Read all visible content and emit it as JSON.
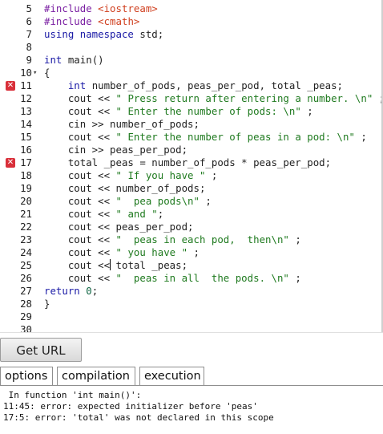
{
  "editor": {
    "lines": [
      {
        "num": "5",
        "tokens": [
          [
            "m",
            "#include "
          ],
          [
            "st",
            "<iostream>"
          ]
        ]
      },
      {
        "num": "6",
        "tokens": [
          [
            "m",
            "#include "
          ],
          [
            "st",
            "<cmath>"
          ]
        ]
      },
      {
        "num": "7",
        "tokens": [
          [
            "k",
            "using namespace"
          ],
          [
            "p",
            " std;"
          ]
        ]
      },
      {
        "num": "8",
        "tokens": []
      },
      {
        "num": "9",
        "tokens": [
          [
            "k",
            "int"
          ],
          [
            "p",
            " main()"
          ]
        ]
      },
      {
        "num": "10",
        "fold": "▾",
        "tokens": [
          [
            "p",
            "{"
          ]
        ]
      },
      {
        "num": "11",
        "error": true,
        "tokens": [
          [
            "p",
            "    "
          ],
          [
            "k",
            "int"
          ],
          [
            "p",
            " number_of_pods, peas_per_pod, total _peas;"
          ]
        ]
      },
      {
        "num": "12",
        "tokens": [
          [
            "p",
            "    cout << "
          ],
          [
            "s",
            "\" Press return after entering a number. \\n\""
          ],
          [
            "p",
            " ;"
          ]
        ]
      },
      {
        "num": "13",
        "tokens": [
          [
            "p",
            "    cout << "
          ],
          [
            "s",
            "\" Enter the number of pods: \\n\""
          ],
          [
            "p",
            " ;"
          ]
        ]
      },
      {
        "num": "14",
        "tokens": [
          [
            "p",
            "    cin >> number_of_pods;"
          ]
        ]
      },
      {
        "num": "15",
        "tokens": [
          [
            "p",
            "    cout << "
          ],
          [
            "s",
            "\" Enter the number of peas in a pod: \\n\""
          ],
          [
            "p",
            " ;"
          ]
        ]
      },
      {
        "num": "16",
        "tokens": [
          [
            "p",
            "    cin >> peas_per_pod;"
          ]
        ]
      },
      {
        "num": "17",
        "error": true,
        "tokens": [
          [
            "p",
            "    total _peas = number_of_pods * peas_per_pod;"
          ]
        ]
      },
      {
        "num": "18",
        "tokens": [
          [
            "p",
            "    cout << "
          ],
          [
            "s",
            "\" If you have \""
          ],
          [
            "p",
            " ;"
          ]
        ]
      },
      {
        "num": "19",
        "tokens": [
          [
            "p",
            "    cout << number_of_pods;"
          ]
        ]
      },
      {
        "num": "20",
        "tokens": [
          [
            "p",
            "    cout << "
          ],
          [
            "s",
            "\"  pea pods\\n\""
          ],
          [
            "p",
            " ;"
          ]
        ]
      },
      {
        "num": "21",
        "tokens": [
          [
            "p",
            "    cout << "
          ],
          [
            "s",
            "\" and \""
          ],
          [
            "p",
            ";"
          ]
        ]
      },
      {
        "num": "22",
        "tokens": [
          [
            "p",
            "    cout << peas_per_pod;"
          ]
        ]
      },
      {
        "num": "23",
        "tokens": [
          [
            "p",
            "    cout << "
          ],
          [
            "s",
            "\"  peas in each pod,  then\\n\""
          ],
          [
            "p",
            " ;"
          ]
        ]
      },
      {
        "num": "24",
        "tokens": [
          [
            "p",
            "    cout << "
          ],
          [
            "s",
            "\" you have \""
          ],
          [
            "p",
            " ;"
          ]
        ]
      },
      {
        "num": "25",
        "cursorLine": true,
        "tokens": [
          [
            "p",
            "    cout <<"
          ],
          [
            "cursor",
            ""
          ],
          [
            "p",
            " total _peas;"
          ]
        ]
      },
      {
        "num": "26",
        "tokens": [
          [
            "p",
            "    cout << "
          ],
          [
            "s",
            "\"  peas in all  the pods. \\n\""
          ],
          [
            "p",
            " ;"
          ]
        ]
      },
      {
        "num": "27",
        "tokens": [
          [
            "k",
            "return "
          ],
          [
            "num",
            "0"
          ],
          [
            "p",
            ";"
          ]
        ]
      },
      {
        "num": "28",
        "tokens": [
          [
            "p",
            "}"
          ]
        ]
      },
      {
        "num": "29",
        "tokens": []
      },
      {
        "num": "30",
        "tokens": []
      }
    ],
    "error_marker_glyph": "✕"
  },
  "toolbar": {
    "get_url_label": "Get URL"
  },
  "tabs": {
    "options": "options",
    "compilation": "compilation",
    "execution": "execution"
  },
  "output": {
    "lines": [
      " In function 'int main()':",
      "11:45: error: expected initializer before 'peas'",
      "17:5: error: 'total' was not declared in this scope"
    ]
  }
}
